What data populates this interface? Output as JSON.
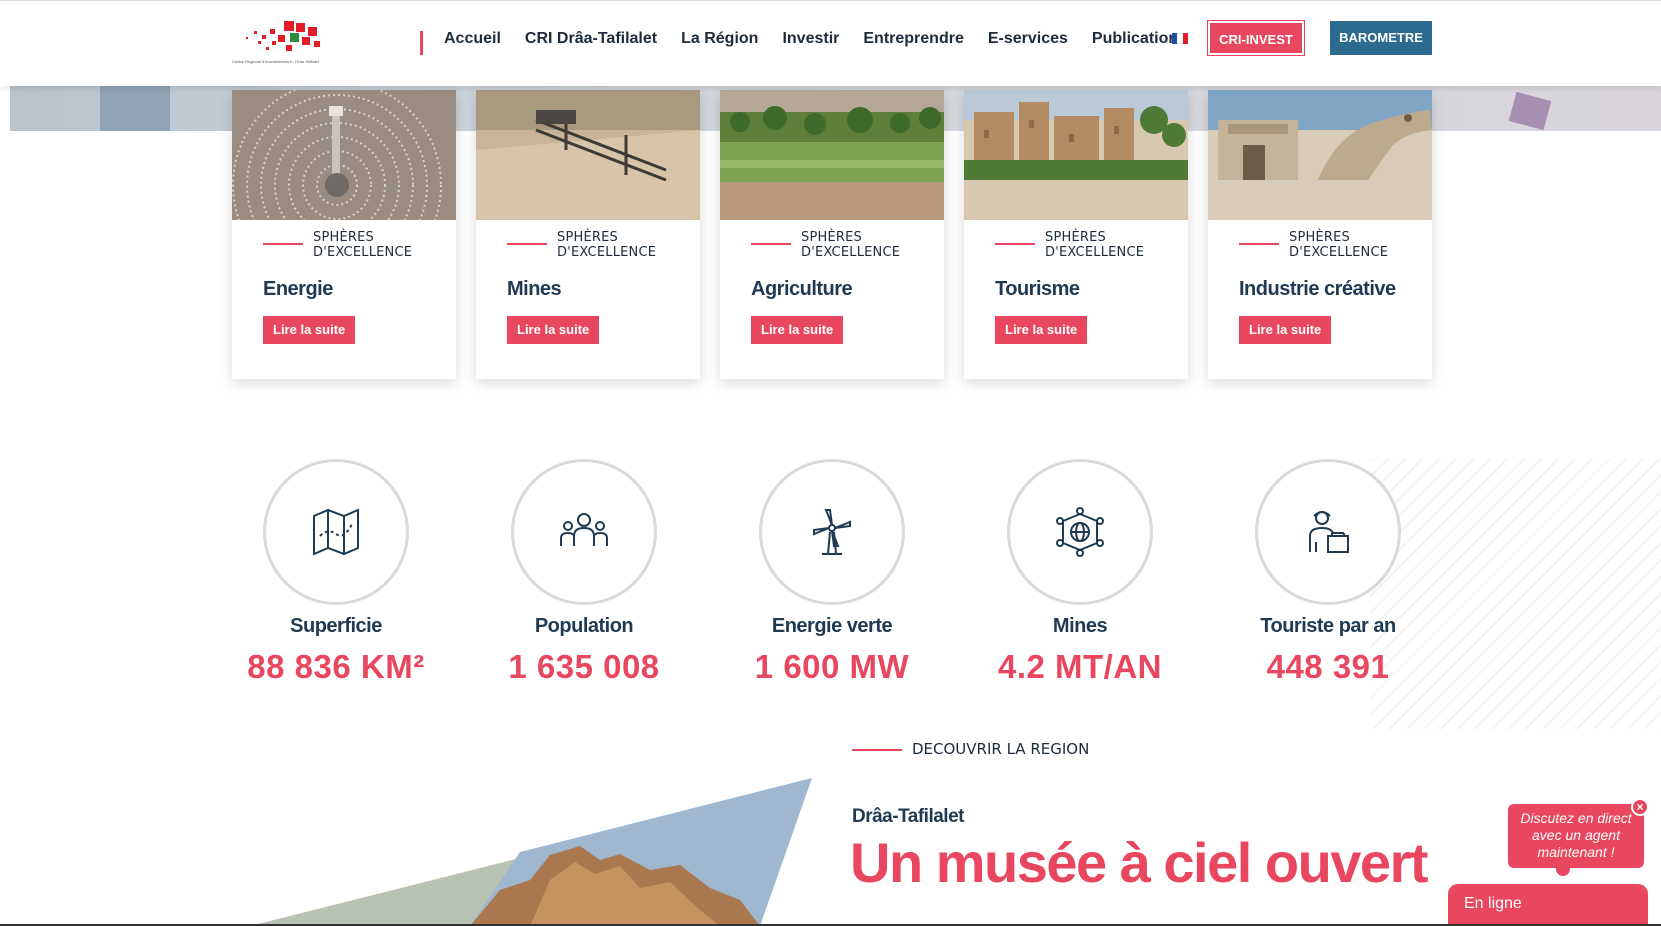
{
  "header": {
    "logo_caption": "Centre Régional d'Investissement - Drâa-Tafilalet",
    "nav": [
      "Accueil",
      "CRI Drâa-Tafilalet",
      "La Région",
      "Investir",
      "Entreprendre",
      "E-services",
      "Publications"
    ],
    "language_flag": "FR",
    "cri_invest": "CRI-INVEST",
    "barometre": "BAROMETRE"
  },
  "cards": [
    {
      "kicker": "SPHÈRES D'EXCELLENCE",
      "title": "Energie",
      "button": "Lire la suite",
      "icon": "solar-plant-image"
    },
    {
      "kicker": "SPHÈRES D'EXCELLENCE",
      "title": "Mines",
      "button": "Lire la suite",
      "icon": "mining-image"
    },
    {
      "kicker": "SPHÈRES D'EXCELLENCE",
      "title": "Agriculture",
      "button": "Lire la suite",
      "icon": "oasis-image"
    },
    {
      "kicker": "SPHÈRES D'EXCELLENCE",
      "title": "Tourisme",
      "button": "Lire la suite",
      "icon": "kasbah-image"
    },
    {
      "kicker": "SPHÈRES D'EXCELLENCE",
      "title": "Industrie créative",
      "button": "Lire la suite",
      "icon": "film-studio-image"
    }
  ],
  "stats": [
    {
      "label": "Superficie",
      "value": "88 836 KM²",
      "icon": "map-icon"
    },
    {
      "label": "Population",
      "value": "1 635 008",
      "icon": "people-icon"
    },
    {
      "label": "Energie verte",
      "value": "1 600 MW",
      "icon": "wind-turbine-icon"
    },
    {
      "label": "Mines",
      "value": "4.2 MT/AN",
      "icon": "network-globe-icon"
    },
    {
      "label": "Touriste par an",
      "value": "448 391",
      "icon": "tourist-icon"
    }
  ],
  "discover": {
    "kicker": "DECOUVRIR LA REGION",
    "subtitle": "Drâa-Tafilalet",
    "title": "Un musée à ciel ouvert"
  },
  "chat": {
    "bubble": "Discutez en direct avec un agent maintenant !",
    "status": "En ligne",
    "close": "×"
  },
  "colors": {
    "accent": "#e8475f",
    "navy": "#1f3a52",
    "blue_button": "#2c6a8f"
  }
}
